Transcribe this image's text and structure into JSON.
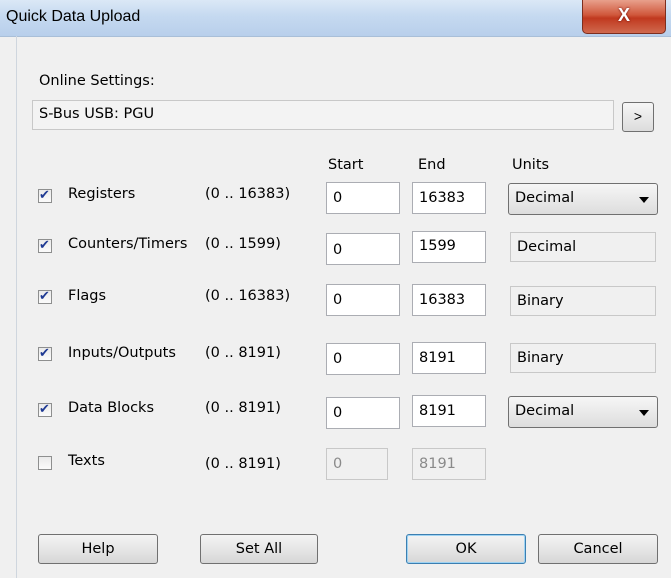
{
  "window": {
    "title": "Quick Data Upload",
    "close_label": "X"
  },
  "online": {
    "label": "Online Settings:",
    "value": "S-Bus USB: PGU",
    "more_label": ">"
  },
  "columns": {
    "start": "Start",
    "end": "End",
    "units": "Units"
  },
  "rows": [
    {
      "label": "Registers",
      "range": "(0 .. 16383)",
      "start": "0",
      "end": "16383",
      "units": "Decimal",
      "checked": true,
      "units_dropdown": true,
      "enabled": true
    },
    {
      "label": "Counters/Timers",
      "range": "(0 .. 1599)",
      "start": "0",
      "end": "1599",
      "units": "Decimal",
      "checked": true,
      "units_dropdown": false,
      "enabled": true
    },
    {
      "label": "Flags",
      "range": "(0 .. 16383)",
      "start": "0",
      "end": "16383",
      "units": "Binary",
      "checked": true,
      "units_dropdown": false,
      "enabled": true
    },
    {
      "label": "Inputs/Outputs",
      "range": "(0 .. 8191)",
      "start": "0",
      "end": "8191",
      "units": "Binary",
      "checked": true,
      "units_dropdown": false,
      "enabled": true
    },
    {
      "label": "Data Blocks",
      "range": "(0 .. 8191)",
      "start": "0",
      "end": "8191",
      "units": "Decimal",
      "checked": true,
      "units_dropdown": true,
      "enabled": true
    },
    {
      "label": "Texts",
      "range": "(0 .. 8191)",
      "start": "0",
      "end": "8191",
      "units": "",
      "checked": false,
      "units_dropdown": false,
      "enabled": false
    }
  ],
  "buttons": {
    "help": "Help",
    "set_all": "Set All",
    "ok": "OK",
    "cancel": "Cancel"
  }
}
